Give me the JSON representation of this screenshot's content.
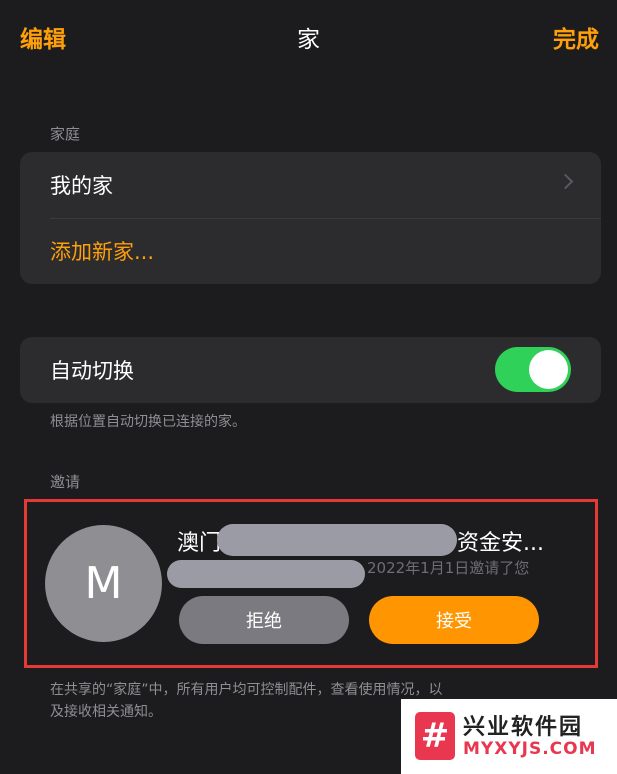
{
  "nav": {
    "edit_label": "编辑",
    "title": "家",
    "done_label": "完成"
  },
  "homes": {
    "section_label": "家庭",
    "items": [
      {
        "label": "我的家"
      },
      {
        "label": "添加新家..."
      }
    ]
  },
  "auto_switch": {
    "label": "自动切换",
    "enabled": true,
    "footnote": "根据位置自动切换已连接的家。"
  },
  "invitations": {
    "section_label": "邀请",
    "avatar_initial": "M",
    "name_start": "澳门",
    "name_end": "资金安...",
    "date_text": "2022年1月1日邀请了您",
    "decline_label": "拒绝",
    "accept_label": "接受",
    "footnote_line1": "在共享的“家庭”中，所有用户均可控制配件，查看使用情况，以",
    "footnote_line2": "及接收相关通知。"
  },
  "watermark": {
    "logo_glyph": "#",
    "title": "兴业软件园",
    "subtitle": "MYXYJS.COM"
  },
  "colors": {
    "accent": "#ff9f0a",
    "toggle_on": "#30d158",
    "highlight_border": "#e53935"
  }
}
